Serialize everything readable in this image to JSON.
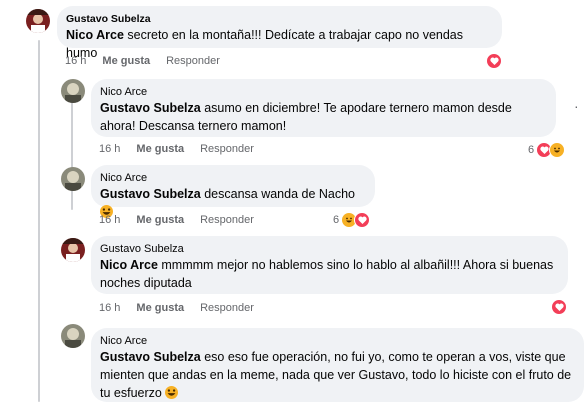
{
  "comments": [
    {
      "author": "Gustavo Subelza",
      "mention": "Nico Arce",
      "text": " secreto en la montaña!!! Dedícate a trabajar capo no vendas humo",
      "time": "16 h",
      "like": "Me gusta",
      "reply": "Responder",
      "reaction_count": ""
    },
    {
      "author": "Nico Arce",
      "mention": "Gustavo Subelza",
      "text": " asumo en diciembre! Te apodare ternero mamon desde ahora! Descansa ternero mamon!",
      "time": "16 h",
      "like": "Me gusta",
      "reply": "Responder",
      "reaction_count": "6"
    },
    {
      "author": "Nico Arce",
      "mention": "Gustavo Subelza",
      "text": " descansa wanda de Nacho ",
      "time": "16 h",
      "like": "Me gusta",
      "reply": "Responder",
      "reaction_count": "6"
    },
    {
      "author": "Gustavo Subelza",
      "mention": "Nico Arce",
      "text": " mmmmm mejor no hablemos sino lo hablo al albañil!!! Ahora si buenas noches diputada",
      "time": "16 h",
      "like": "Me gusta",
      "reply": "Responder",
      "reaction_count": ""
    },
    {
      "author": "Nico Arce",
      "mention": "Gustavo Subelza",
      "text": " eso eso fue operación, no fui yo, como te operan a vos, viste que mienten que andas en la meme, nada que ver Gustavo, todo lo hiciste con el fruto de tu esfuerzo ",
      "time": "",
      "like": "",
      "reply": "",
      "reaction_count": ""
    }
  ],
  "colors": {
    "bubble": "#f0f2f5",
    "meta": "#65676b",
    "heart": "#f33e58",
    "haha": "#f7b125"
  },
  "icons": [
    "heart-reaction-icon",
    "haha-reaction-icon",
    "more-options-icon"
  ]
}
